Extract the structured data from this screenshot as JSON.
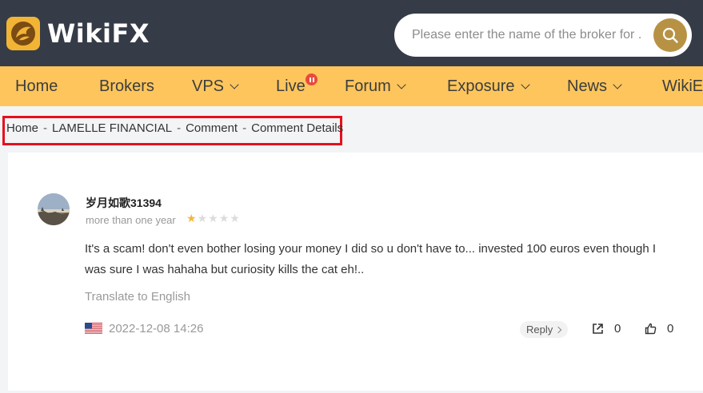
{
  "header": {
    "brand": "WikiFX",
    "search_placeholder": "Please enter the name of the broker for ..."
  },
  "nav": {
    "items": [
      {
        "label": "Home",
        "dropdown": false
      },
      {
        "label": "Brokers",
        "dropdown": false
      },
      {
        "label": "VPS",
        "dropdown": true
      },
      {
        "label": "Live",
        "dropdown": false,
        "badge": "live-indicator"
      },
      {
        "label": "Forum",
        "dropdown": true
      },
      {
        "label": "Exposure",
        "dropdown": true
      },
      {
        "label": "News",
        "dropdown": true
      },
      {
        "label": "WikiEX",
        "dropdown": false
      }
    ]
  },
  "breadcrumb": {
    "items": [
      "Home",
      "LAMELLE FINANCIAL",
      "Comment",
      "Comment Details"
    ],
    "separator": "-"
  },
  "comment": {
    "username": "岁月如歌31394",
    "time_ago": "more than one year",
    "rating": 1,
    "rating_max": 5,
    "text": "It's a scam! don't even bother losing your money I did so u don't have to... invested 100 euros even though I was sure I was hahaha but curiosity kills the cat eh!..",
    "translate_label": "Translate to English",
    "country_flag": "us-flag-icon",
    "date": "2022-12-08 14:26",
    "reply_label": "Reply",
    "share_count": "0",
    "like_count": "0"
  },
  "colors": {
    "topbar": "#363c47",
    "nav": "#fdc55c",
    "logo": "#f2b435",
    "search_button": "#b89244",
    "star_on": "#f4b73b",
    "highlight_box": "#e5101d"
  }
}
